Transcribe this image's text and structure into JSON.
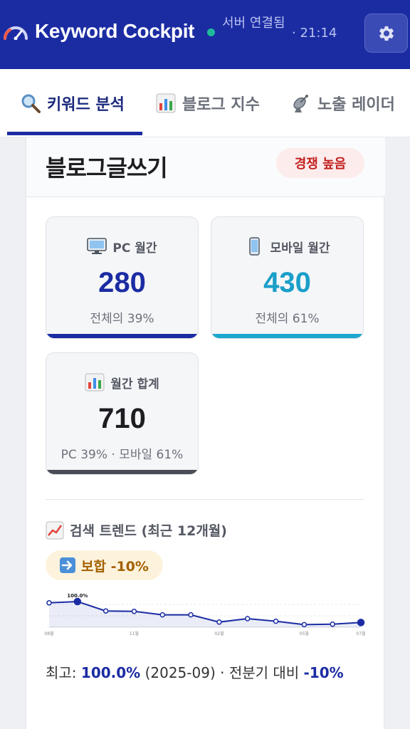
{
  "app": {
    "title": "Keyword Cockpit",
    "status": "서버 연결됨",
    "time": "· 21:14"
  },
  "tabs": [
    {
      "label": "키워드 분석",
      "icon": "magnifier-icon",
      "active": true
    },
    {
      "label": "블로그 지수",
      "icon": "bar-chart-icon",
      "active": false
    },
    {
      "label": "노출 레이더",
      "icon": "satellite-dish-icon",
      "active": false
    }
  ],
  "keyword": {
    "name": "블로그글쓰기",
    "competition": "경쟁 높음"
  },
  "stats": {
    "pc": {
      "label": "PC 월간",
      "value": "280",
      "sub": "전체의 39%",
      "color": "#1b2ca3"
    },
    "mobile": {
      "label": "모바일 월간",
      "value": "430",
      "sub": "전체의 61%",
      "color": "#1a9fc9"
    },
    "total": {
      "label": "월간 합계",
      "value": "710",
      "sub": "PC 39% · 모바일 61%",
      "color": "#4a4d55"
    }
  },
  "trend": {
    "title": "검색 트렌드 (최근 12개월)",
    "badge": "보합 -10%",
    "summary_label": "최고: ",
    "summary_peak": "100.0%",
    "summary_date": " (2025-09)",
    "summary_compare": " · 전분기 대비 ",
    "summary_change": "-10%"
  },
  "chart_data": {
    "type": "line",
    "x": [
      "08월",
      "09월",
      "10월",
      "11월",
      "12월",
      "01월",
      "02월",
      "03월",
      "04월",
      "05월",
      "06월",
      "07월"
    ],
    "tick_labels": [
      "08월",
      "11월",
      "02월",
      "05월",
      "07월"
    ],
    "values": [
      97,
      100,
      78,
      77,
      69,
      69,
      52,
      60,
      54,
      46,
      47,
      51
    ],
    "peak_label": "100.0%",
    "ylim": [
      40,
      110
    ],
    "line_color": "#1b2ca3"
  }
}
